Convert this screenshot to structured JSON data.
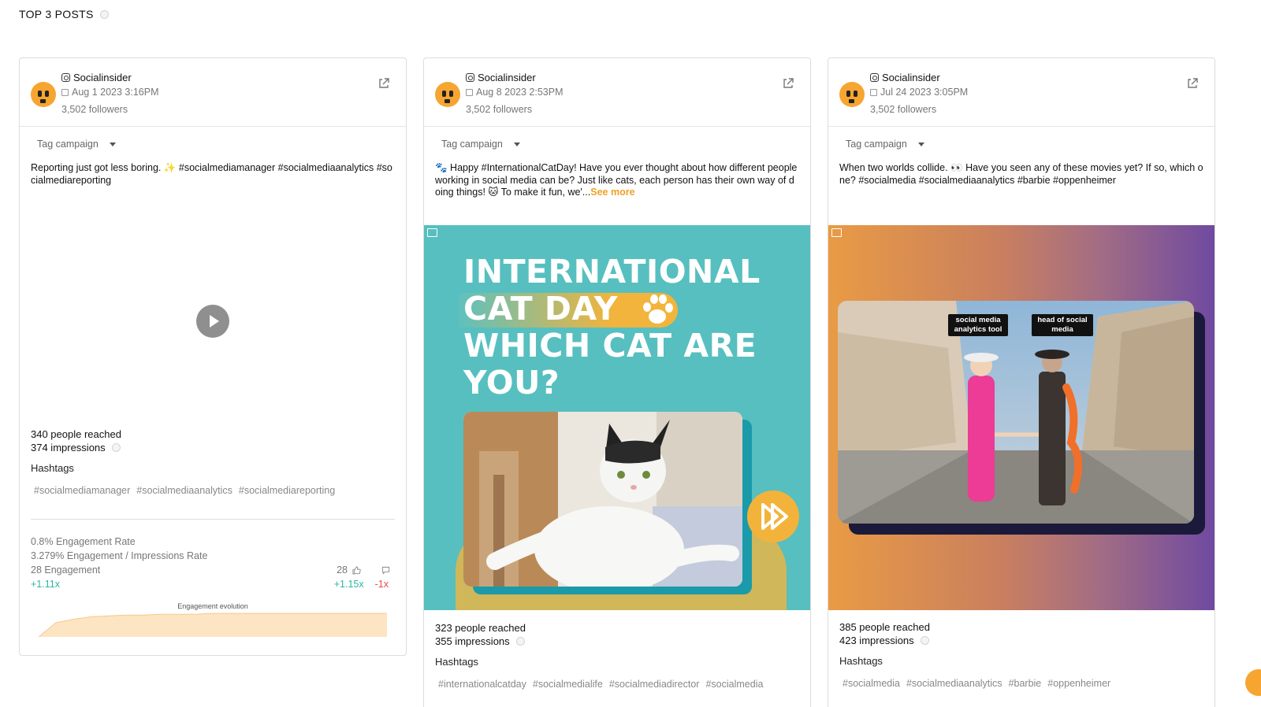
{
  "section": {
    "title": "TOP 3 POSTS"
  },
  "posts": [
    {
      "account": "Socialinsider",
      "date": "Aug 1 2023 3:16PM",
      "followers": "3,502 followers",
      "tag_label": "Tag campaign",
      "caption": "Reporting just got less boring. ✨ #socialmediamanager #socialmediaanalytics #socialmediareporting",
      "reached": "340 people reached",
      "impressions": "374 impressions",
      "hashtags_label": "Hashtags",
      "hashtags": [
        "#socialmediamanager",
        "#socialmediaanalytics",
        "#socialmediareporting"
      ],
      "engagement_rate": "0.8% Engagement Rate",
      "engagement_impressions_rate": "3.279% Engagement / Impressions Rate",
      "engagement": "28 Engagement",
      "likes": "28",
      "mult_left": "+1.11x",
      "mult_likes": "+1.15x",
      "mult_comments": "-1x",
      "evolution_label": "Engagement evolution"
    },
    {
      "account": "Socialinsider",
      "date": "Aug 8 2023 2:53PM",
      "followers": "3,502 followers",
      "tag_label": "Tag campaign",
      "caption": "🐾 Happy #InternationalCatDay! Have you ever thought about how different people working in social media can be? Just like cats, each person has their own way of doing things! 🐱 To make it fun, we'...",
      "see_more": "See more",
      "image_lines": [
        "INTERNATIONAL",
        "CAT DAY",
        "WHICH CAT ARE",
        "YOU?"
      ],
      "reached": "323 people reached",
      "impressions": "355 impressions",
      "hashtags_label": "Hashtags",
      "hashtags": [
        "#internationalcatday",
        "#socialmedialife",
        "#socialmediadirector",
        "#socialmedia"
      ]
    },
    {
      "account": "Socialinsider",
      "date": "Jul 24 2023 3:05PM",
      "followers": "3,502 followers",
      "tag_label": "Tag campaign",
      "caption": "When two worlds collide. 👀 Have you seen any of these movies yet? If so, which one? #socialmedia #socialmediaanalytics #barbie #oppenheimer",
      "image_label_left": "social media analytics tool",
      "image_label_right": "head of social media",
      "reached": "385 people reached",
      "impressions": "423 impressions",
      "hashtags_label": "Hashtags",
      "hashtags": [
        "#socialmedia",
        "#socialmediaanalytics",
        "#barbie",
        "#oppenheimer"
      ]
    }
  ],
  "chart_data": {
    "type": "area",
    "title": "Engagement evolution",
    "x": [
      0,
      1,
      2,
      3,
      4,
      5,
      6,
      7,
      8,
      9,
      10,
      11,
      12,
      13,
      14,
      15,
      16,
      17,
      18,
      19,
      20
    ],
    "values": [
      0,
      17,
      21,
      24,
      25,
      26,
      26,
      27,
      27,
      27,
      28,
      28,
      28,
      28,
      28,
      28,
      28,
      28,
      28,
      28,
      28
    ],
    "ylim": [
      0,
      30
    ],
    "grid": false,
    "color": "#fde5c4"
  },
  "colors": {
    "accent": "#f0a024",
    "positive": "#2bb5a5",
    "negative": "#e84b4b",
    "avatar": "#f6a531"
  },
  "icons": {
    "account": "instagram-icon",
    "date": "calendar-icon",
    "external": "external-link-icon",
    "media": "image-icon"
  }
}
